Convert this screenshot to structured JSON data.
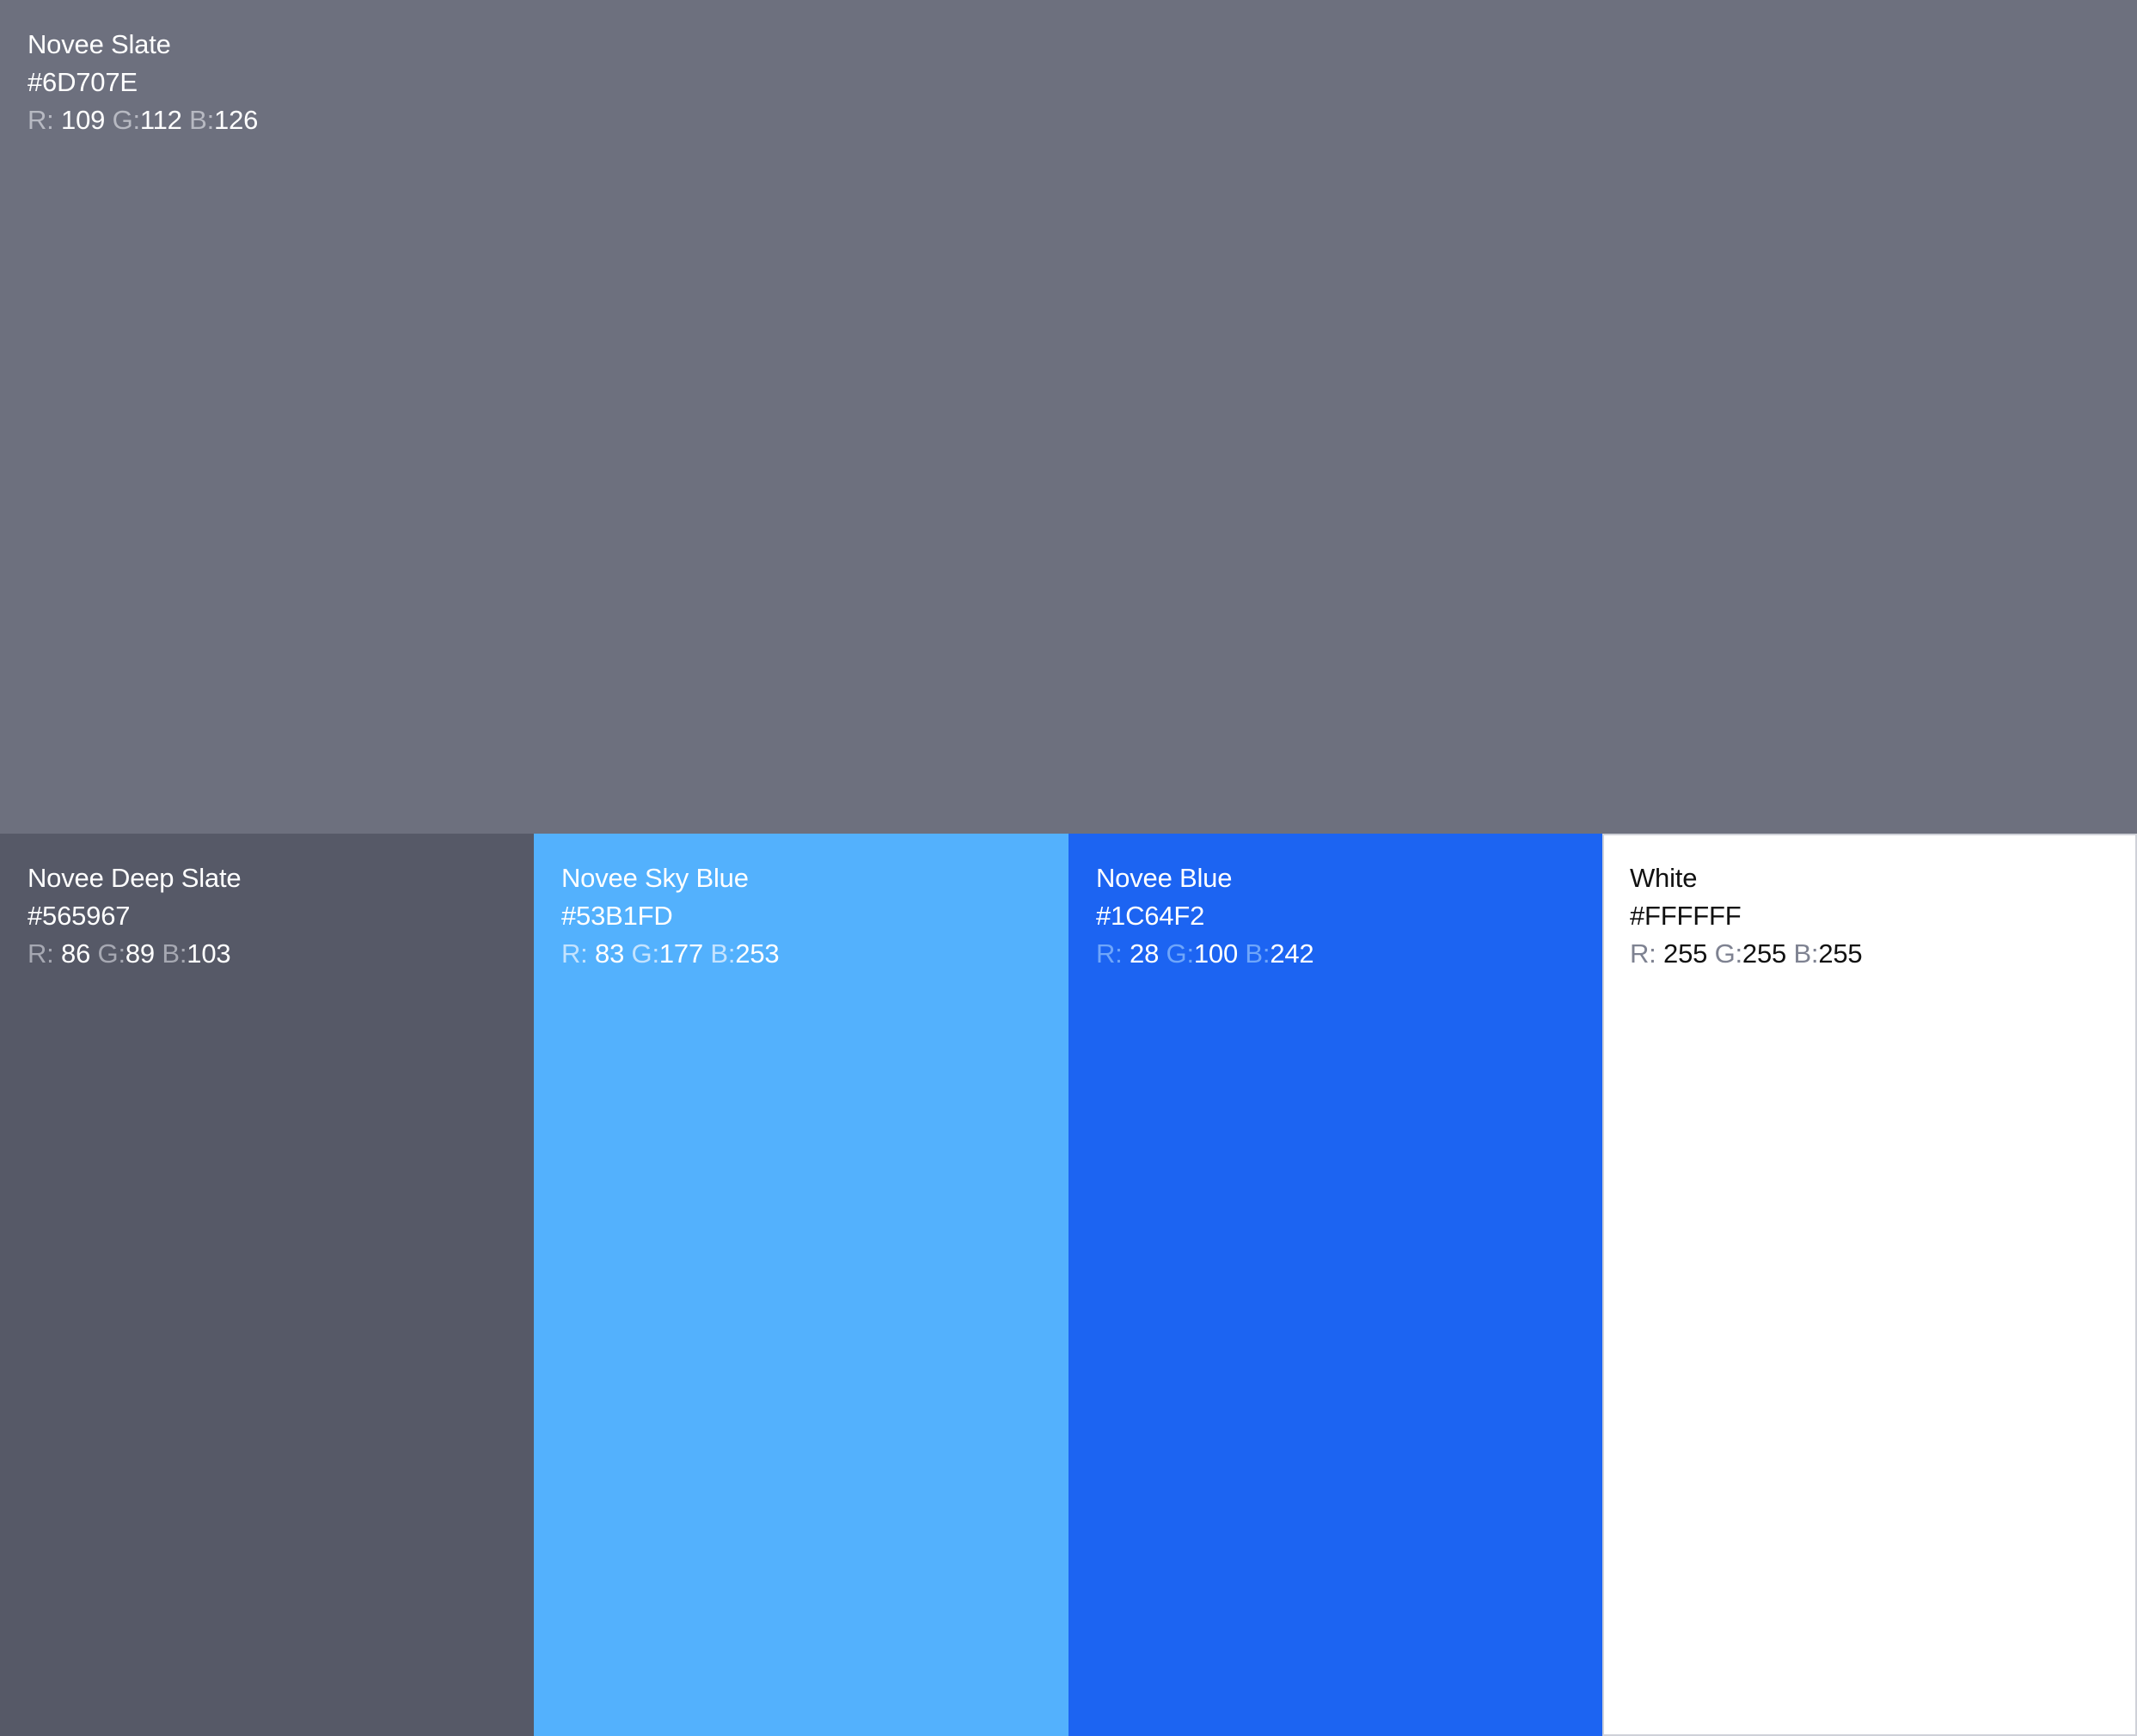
{
  "swatches": [
    {
      "name": "Novee Slate",
      "hex": "#6D707E",
      "r": "109",
      "g": "112",
      "b": "126",
      "background": "#6D707E",
      "text_color": "#FFFFFF",
      "key_color": "#B7B9C2"
    },
    {
      "name": "Novee Deep Slate",
      "hex": "#565967",
      "r": "86",
      "g": "89",
      "b": "103",
      "background": "#565967",
      "text_color": "#FFFFFF",
      "key_color": "#A6A8B2"
    },
    {
      "name": "Novee Sky Blue",
      "hex": "#53B1FD",
      "r": "83",
      "g": "177",
      "b": "253",
      "background": "#53B1FD",
      "text_color": "#FFFFFF",
      "key_color": "#C4E3FE"
    },
    {
      "name": "Novee Blue",
      "hex": "#1C64F2",
      "r": "28",
      "g": "100",
      "b": "242",
      "background": "#1C64F2",
      "text_color": "#FFFFFF",
      "key_color": "#6FA6FA"
    },
    {
      "name": "White",
      "hex": "#FFFFFF",
      "r": "255",
      "g": "255",
      "b": "255",
      "background": "#FFFFFF",
      "text_color": "#111111",
      "key_color": "#7E8291"
    }
  ],
  "labels": {
    "r_key": "R:",
    "g_key": "G:",
    "b_key": "B:"
  }
}
